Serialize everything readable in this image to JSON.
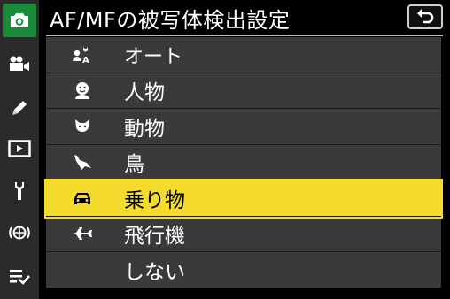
{
  "header": {
    "title": "AF/MFの被写体検出設定"
  },
  "sidebar": {
    "tabs": [
      {
        "icon": "camera-icon",
        "active": true
      },
      {
        "icon": "movie-camera-icon",
        "active": false
      },
      {
        "icon": "pencil-icon",
        "active": false
      },
      {
        "icon": "playback-icon",
        "active": false
      },
      {
        "icon": "wrench-icon",
        "active": false
      },
      {
        "icon": "network-icon",
        "active": false
      },
      {
        "icon": "my-menu-icon",
        "active": false
      }
    ]
  },
  "menu": {
    "items": [
      {
        "label": "オート",
        "icon": "auto-subject-icon",
        "selected": false
      },
      {
        "label": "人物",
        "icon": "face-icon",
        "selected": false
      },
      {
        "label": "動物",
        "icon": "animal-icon",
        "selected": false
      },
      {
        "label": "鳥",
        "icon": "bird-icon",
        "selected": false
      },
      {
        "label": "乗り物",
        "icon": "car-icon",
        "selected": true
      },
      {
        "label": "飛行機",
        "icon": "airplane-icon",
        "selected": false
      },
      {
        "label": "しない",
        "icon": "",
        "selected": false
      }
    ]
  },
  "colors": {
    "highlight": "#f5dc2c",
    "active_tab": "#1c8a3b",
    "row_bg": "#3a3a3a"
  }
}
